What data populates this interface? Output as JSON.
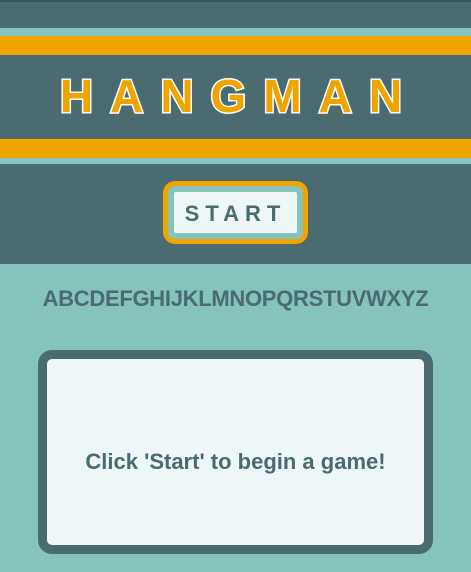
{
  "title": "HANGMAN",
  "start_label": "START",
  "alphabet": [
    "A",
    "B",
    "C",
    "D",
    "E",
    "F",
    "G",
    "H",
    "I",
    "J",
    "K",
    "L",
    "M",
    "N",
    "O",
    "P",
    "Q",
    "R",
    "S",
    "T",
    "U",
    "V",
    "W",
    "X",
    "Y",
    "Z"
  ],
  "message": "Click 'Start' to begin a game!",
  "colors": {
    "dark_teal": "#4a6b70",
    "light_teal": "#84c4bd",
    "accent_orange": "#f0a400",
    "panel_white": "#eef6f8"
  }
}
